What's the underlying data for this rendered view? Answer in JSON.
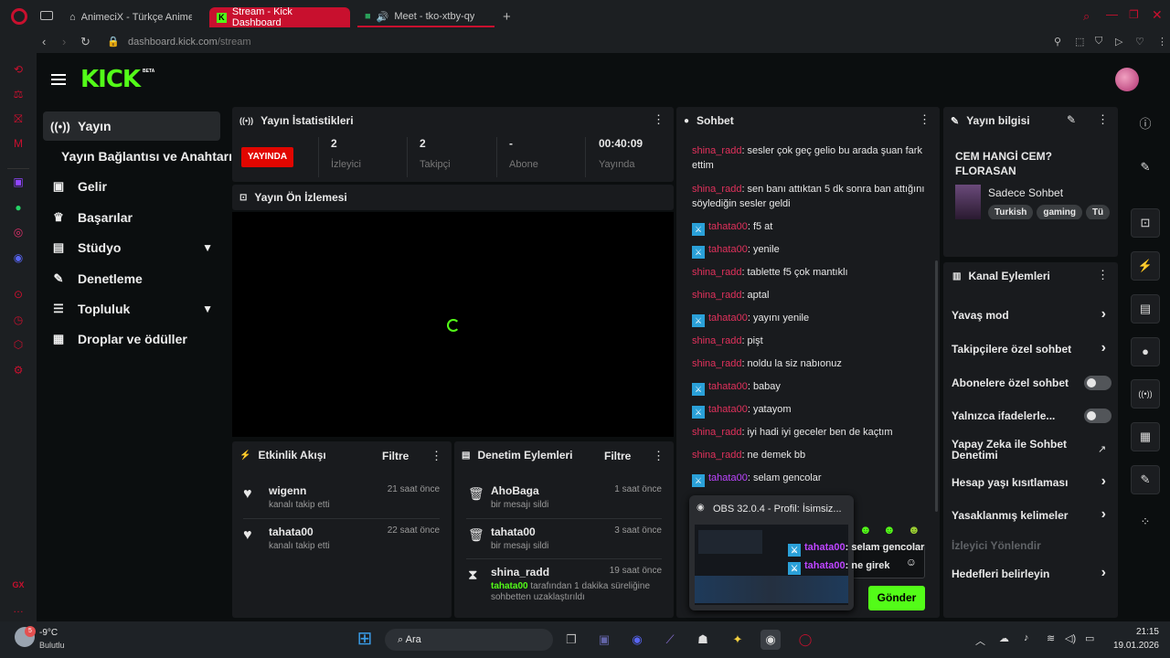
{
  "browser": {
    "tabs": [
      {
        "label": "AnimeciX - Türkçe Anime İ"
      },
      {
        "label": "Stream - Kick Dashboard"
      },
      {
        "label": "Meet - tko-xtby-qy"
      }
    ],
    "new_tab": "+",
    "url_host": "dashboard.kick.com",
    "url_path": "/stream"
  },
  "kick": {
    "logo": "KICK",
    "logo_badge": "BETA"
  },
  "sidebar": {
    "items": [
      {
        "label": "Yayın",
        "icon": "broadcast-icon"
      },
      {
        "label": "Yayın Bağlantısı ve Anahtarı",
        "icon": ""
      },
      {
        "label": "Gelir",
        "icon": "wallet-icon"
      },
      {
        "label": "Başarılar",
        "icon": "trophy-icon"
      },
      {
        "label": "Stüdyo",
        "icon": "studio-icon"
      },
      {
        "label": "Denetleme",
        "icon": "wrench-icon"
      },
      {
        "label": "Topluluk",
        "icon": "community-icon"
      },
      {
        "label": "Droplar ve ödüller",
        "icon": "gift-icon"
      }
    ]
  },
  "stats": {
    "title": "Yayın İstatistikleri",
    "live_badge": "YAYINDA",
    "cells": [
      {
        "value": "2",
        "label": "İzleyici"
      },
      {
        "value": "2",
        "label": "Takipçi"
      },
      {
        "value": "-",
        "label": "Abone"
      },
      {
        "value": "00:40:09",
        "label": "Yayında"
      }
    ]
  },
  "preview": {
    "title": "Yayın Ön İzlemesi"
  },
  "activity": {
    "title": "Etkinlik Akışı",
    "filter": "Filtre",
    "events": [
      {
        "name": "wigenn",
        "sub": "kanalı takip etti",
        "time": "21 saat önce"
      },
      {
        "name": "tahata00",
        "sub": "kanalı takip etti",
        "time": "22 saat önce"
      }
    ]
  },
  "moderation": {
    "title": "Denetim Eylemleri",
    "filter": "Filtre",
    "events": [
      {
        "name": "AhoBaga",
        "sub": "bir mesajı sildi",
        "time": "1 saat önce"
      },
      {
        "name": "tahata00",
        "sub": "bir mesajı sildi",
        "time": "3 saat önce"
      },
      {
        "name": "shina_radd",
        "sub_user": "tahata00",
        "sub": "tarafından 1 dakika süreliğine sohbetten uzaklaştırıldı",
        "time": "19 saat önce"
      }
    ]
  },
  "chat": {
    "title": "Sohbet",
    "messages": [
      {
        "user": "shina_radd",
        "text": ": sesler çok geç gelio bu arada şuan fark ettim"
      },
      {
        "user": "shina_radd",
        "text": ": sen banı attıktan 5 dk sonra ban attığını söylediğin sesler geldi"
      },
      {
        "user": "tahata00",
        "text": ": f5 at"
      },
      {
        "user": "tahata00",
        "text": ": yenile"
      },
      {
        "user": "shina_radd",
        "text": ": tablette f5 çok mantıklı"
      },
      {
        "user": "shina_radd",
        "text": ": aptal"
      },
      {
        "user": "tahata00",
        "text": ": yayını yenile"
      },
      {
        "user": "shina_radd",
        "text": ": pişt"
      },
      {
        "user": "shina_radd",
        "text": ": noldu la siz nabıonuz"
      },
      {
        "user": "tahata00",
        "text": ": babay"
      },
      {
        "user": "tahata00",
        "text": ": yatayom"
      },
      {
        "user": "shina_radd",
        "text": ": iyi hadi iyi geceler ben de kaçtım"
      },
      {
        "user": "shina_radd",
        "text": ": ne demek bb"
      },
      {
        "user": "tahata00",
        "text": ": selam gencolar"
      }
    ],
    "send": "Gönder"
  },
  "obs_preview": {
    "title": "OBS 32.0.4 - Profil: İsimsiz...",
    "lines": [
      {
        "user": "tahata00",
        "text": ": selam gencolar"
      },
      {
        "user": "tahata00",
        "text": ": ne girek"
      }
    ]
  },
  "stream_info": {
    "title": "Yayın bilgisi",
    "stream_title": "CEM HANGİ CEM? FLORASAN",
    "category": "Sadece Sohbet",
    "tags": [
      "Turkish",
      "gaming",
      "Tü"
    ]
  },
  "channel_actions": {
    "title": "Kanal Eylemleri",
    "items": [
      {
        "label": "Yavaş mod",
        "kind": "chevron"
      },
      {
        "label": "Takipçilere özel sohbet",
        "kind": "chevron"
      },
      {
        "label": "Abonelere özel sohbet",
        "kind": "toggle"
      },
      {
        "label": "Yalnızca ifadelerle...",
        "kind": "toggle"
      },
      {
        "label": "Yapay Zeka ile Sohbet Denetimi",
        "kind": "external"
      },
      {
        "label": "Hesap yaşı kısıtlaması",
        "kind": "chevron"
      },
      {
        "label": "Yasaklanmış kelimeler",
        "kind": "chevron"
      },
      {
        "label": "İzleyici Yönlendir",
        "kind": "disabled"
      },
      {
        "label": "Hedefleri belirleyin",
        "kind": "chevron"
      }
    ]
  },
  "taskbar": {
    "temp": "-9°C",
    "weather": "Bulutlu",
    "search": "Ara",
    "time": "21:15",
    "date": "19.01.2026"
  },
  "colors": {
    "kick_green": "#53fc18",
    "brand_red": "#c8102e",
    "live_red": "#e10600"
  }
}
